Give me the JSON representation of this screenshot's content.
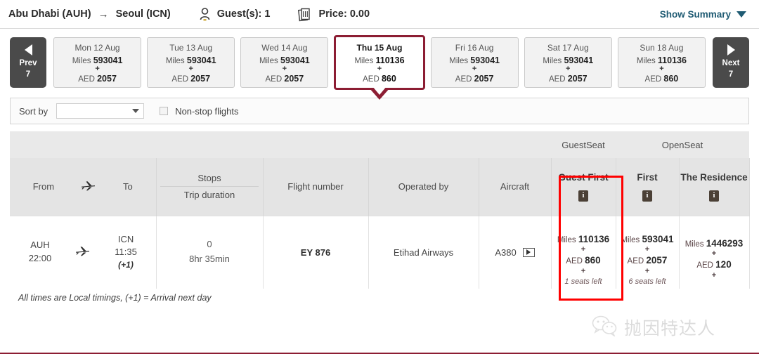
{
  "header": {
    "origin": "Abu Dhabi (AUH)",
    "arrow": "→",
    "destination": "Seoul (ICN)",
    "guests_label": "Guest(s): 1",
    "price_label": "Price: 0.00",
    "show_summary": "Show Summary",
    "guest_icon": "person-icon",
    "price_icon": "money-notes-icon",
    "caret_icon": "chevron-down-icon"
  },
  "date_strip": {
    "prev": {
      "label": "Prev",
      "count": "7",
      "icon": "chevron-left-icon"
    },
    "next": {
      "label": "Next",
      "count": "7",
      "icon": "chevron-right-icon"
    },
    "miles_label": "Miles",
    "currency_label": "AED",
    "plus": "+",
    "tiles": [
      {
        "date": "Mon 12 Aug",
        "miles": "593041",
        "aed": "2057",
        "selected": false
      },
      {
        "date": "Tue 13 Aug",
        "miles": "593041",
        "aed": "2057",
        "selected": false
      },
      {
        "date": "Wed 14 Aug",
        "miles": "593041",
        "aed": "2057",
        "selected": false
      },
      {
        "date": "Thu 15 Aug",
        "miles": "110136",
        "aed": "860",
        "selected": true
      },
      {
        "date": "Fri 16 Aug",
        "miles": "593041",
        "aed": "2057",
        "selected": false
      },
      {
        "date": "Sat 17 Aug",
        "miles": "593041",
        "aed": "2057",
        "selected": false
      },
      {
        "date": "Sun 18 Aug",
        "miles": "110136",
        "aed": "860",
        "selected": false
      }
    ]
  },
  "filters": {
    "sort_label": "Sort by",
    "sort_value": "",
    "nonstop_label": "Non-stop flights",
    "nonstop_checked": false
  },
  "table": {
    "seat_groups": [
      {
        "label": "GuestSeat"
      },
      {
        "label": "OpenSeat"
      }
    ],
    "columns": {
      "from": "From",
      "to": "To",
      "plane_icon": "airplane-icon",
      "stops": "Stops",
      "trip_duration": "Trip duration",
      "flight_number": "Flight number",
      "operated_by": "Operated by",
      "aircraft": "Aircraft"
    },
    "fare_columns": [
      {
        "title": "Guest First",
        "info_icon": "info-icon",
        "color": "#cc9a9d"
      },
      {
        "title": "First",
        "info_icon": "info-icon",
        "color": "#bf8e91"
      },
      {
        "title": "The Residence",
        "info_icon": "info-icon",
        "color": "#a8989f"
      }
    ],
    "rows": [
      {
        "from_code": "AUH",
        "from_time": "22:00",
        "to_code": "ICN",
        "to_time": "11:35",
        "next_day": "(+1)",
        "stops": "0",
        "duration": "8hr 35min",
        "flight_number": "EY 876",
        "operated_by": "Etihad Airways",
        "aircraft": "A380",
        "aircraft_icon": "play-button-icon",
        "fares": [
          {
            "miles_label": "Miles",
            "miles": "110136",
            "plus": "+",
            "currency": "AED",
            "amount": "860",
            "seats_left": "1 seats left"
          },
          {
            "miles_label": "Miles",
            "miles": "593041",
            "plus": "+",
            "currency": "AED",
            "amount": "2057",
            "seats_left": "6 seats left"
          },
          {
            "miles_label": "Miles",
            "miles": "1446293",
            "plus": "+",
            "currency": "AED",
            "amount": "120",
            "seats_left": ""
          }
        ]
      }
    ]
  },
  "footnote": "All times are Local timings, (+1) = Arrival next day",
  "watermark": {
    "text": "抛因特达人",
    "icon": "wechat-icon"
  },
  "colors": {
    "selected_border": "#8c1d33",
    "annotation": "#ff0000",
    "link": "#1f5b73"
  }
}
